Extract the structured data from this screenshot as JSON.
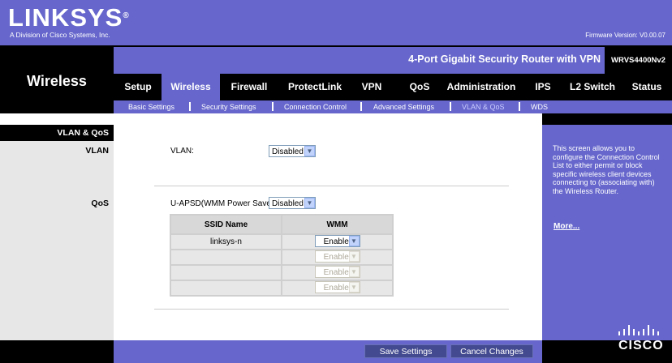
{
  "brand": {
    "logo": "LINKSYS",
    "logo_mark": "®",
    "subtitle": "A Division of Cisco Systems, Inc.",
    "firmware": "Firmware Version: V0.00.07"
  },
  "section_title": "Wireless",
  "product": {
    "title": "4-Port Gigabit Security Router with VPN",
    "model": "WRVS4400Nv2"
  },
  "tabs": [
    {
      "label": "Setup",
      "active": false
    },
    {
      "label": "Wireless",
      "active": true
    },
    {
      "label": "Firewall",
      "active": false
    },
    {
      "label": "ProtectLink",
      "active": false
    },
    {
      "label": "VPN",
      "active": false
    },
    {
      "label": "QoS",
      "active": false
    },
    {
      "label": "Administration",
      "active": false
    },
    {
      "label": "IPS",
      "active": false
    },
    {
      "label": "L2 Switch",
      "active": false
    },
    {
      "label": "Status",
      "active": false
    }
  ],
  "subtabs": [
    {
      "label": "Basic Settings",
      "active": false
    },
    {
      "label": "Security Settings",
      "active": false
    },
    {
      "label": "Connection Control",
      "active": false
    },
    {
      "label": "Advanced Settings",
      "active": false
    },
    {
      "label": "VLAN & QoS",
      "active": true
    },
    {
      "label": "WDS",
      "active": false
    }
  ],
  "sidebar": {
    "header": "VLAN & QoS",
    "vlan": "VLAN",
    "qos": "QoS"
  },
  "form": {
    "vlan_label": "VLAN:",
    "vlan_value": "Disabled",
    "uapsd_label": "U-APSD(WMM Power Save):",
    "uapsd_value": "Disabled",
    "table": {
      "col_ssid": "SSID Name",
      "col_wmm": "WMM",
      "rows": [
        {
          "ssid": "linksys-n",
          "wmm": "Enabled",
          "disabled": false
        },
        {
          "ssid": "",
          "wmm": "Enabled",
          "disabled": true
        },
        {
          "ssid": "",
          "wmm": "Enabled",
          "disabled": true
        },
        {
          "ssid": "",
          "wmm": "Enabled",
          "disabled": true
        }
      ]
    }
  },
  "help": {
    "text": "This screen allows you to configure the Connection Control List to either permit or block specific wireless client devices connecting to (associating with) the Wireless Router.",
    "more": "More..."
  },
  "footer": {
    "save": "Save Settings",
    "cancel": "Cancel Changes"
  },
  "cisco": "CISCO",
  "colors": {
    "accent": "#6666cc",
    "dark": "#000000",
    "sidebar": "#e7e7e7"
  }
}
